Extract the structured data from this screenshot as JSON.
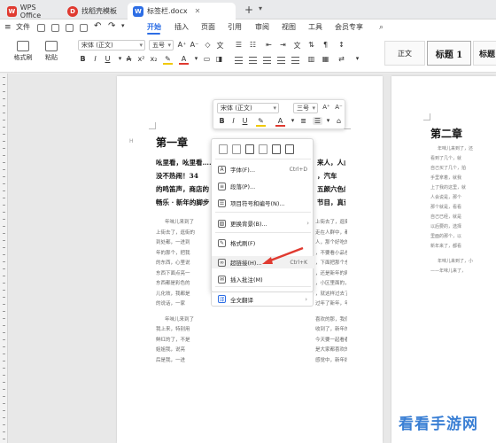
{
  "tabs": [
    {
      "label": "WPS Office"
    },
    {
      "label": "找稻壳模板"
    },
    {
      "label": "标签栏.docx"
    }
  ],
  "menu": {
    "file": "文件",
    "tabs": [
      "开始",
      "插入",
      "页面",
      "引用",
      "审阅",
      "视图",
      "工具",
      "会员专享"
    ],
    "active": "开始"
  },
  "ribbon": {
    "format_painter": "格式刷",
    "paste": "粘贴",
    "font_name": "宋体 (正文)",
    "font_size": "五号",
    "bold": "B",
    "italic": "I",
    "underline": "U",
    "font_color_label": "A",
    "styles": [
      "正文",
      "标题 1",
      "标题"
    ]
  },
  "page1": {
    "heading_marker": "H",
    "chapter_title": "第一章",
    "bold_lines": [
      "吆里看，吆里看……",
      "没不热闹！34",
      "的鸣笛声，商店的",
      "畅乐 · 新年的脚步"
    ],
    "bold_lines_right": [
      "来人，人山人",
      "，汽车",
      "五颜六色的彩",
      "节目，真诚的欢"
    ],
    "text_lines": [
      "年味儿来到了",
      "上街去了，逛街的",
      "到处都，一进到",
      "年的那个，把我",
      "的东西，心里说",
      "东西下面点亮一",
      "东西都是彩色的",
      "儿化效，我都是",
      "的说话，一家",
      "年味儿来到了",
      "我上来，特别用",
      "鲜红的了，不是",
      "姐姐我，说亮",
      "后是我，一进"
    ],
    "text_lines_right": [
      "上街去了，逛街一上",
      "走在人群中，都看到了",
      "人，那个好吃的什么",
      "，不要看小品也不",
      "，下面把那个东西",
      "，还是新年的彩灯",
      "，小区里面的，人",
      "，就这样过去了",
      "过年了新年，年来了",
      "喜欢的那，我们一起",
      "收到了，新年的新",
      "今天要一起看春晚",
      "是大家都喜欢的",
      "感觉中，新年好"
    ]
  },
  "page2": {
    "chapter_title": "第二章",
    "text_lines": [
      "年味儿来到了，还",
      "看到了几个，就",
      "自己买了几个，拍",
      "手里拿着，就我",
      "上了我的这里，就",
      "人会说是，那个",
      "那个就是，看看",
      "自己已经，就是",
      "以后要的，选择",
      "里面的那个，以",
      "新年来了，都看",
      "年味儿来到了，小",
      "——年味儿来了，"
    ]
  },
  "mini_toolbar": {
    "font_name": "宋体 (正文)",
    "font_size": "三号",
    "bold": "B",
    "italic": "I",
    "underline": "U",
    "font_color": "A"
  },
  "context_menu": {
    "items": [
      {
        "label": "字体(F)...",
        "shortcut": "Ctrl+D",
        "icon": "font-icon"
      },
      {
        "label": "段落(P)...",
        "shortcut": "",
        "icon": "paragraph-icon"
      },
      {
        "label": "项目符号和编号(N)...",
        "shortcut": "",
        "icon": "list-icon"
      },
      {
        "label": "更换背景(B)...",
        "shortcut": "",
        "icon": "background-icon"
      },
      {
        "label": "格式刷(F)",
        "shortcut": "",
        "icon": "format-painter-icon"
      },
      {
        "label": "超链接(H)...",
        "shortcut": "Ctrl+K",
        "icon": "link-icon"
      },
      {
        "label": "插入批注(M)",
        "shortcut": "",
        "icon": "comment-icon"
      },
      {
        "label": "全文翻译",
        "shortcut": "",
        "icon": "translate-icon"
      }
    ]
  },
  "watermark": "看看手游网",
  "colors": {
    "accent": "#2d6ee5",
    "arrow": "#e03a30",
    "watermark": "#3a7fd4"
  }
}
